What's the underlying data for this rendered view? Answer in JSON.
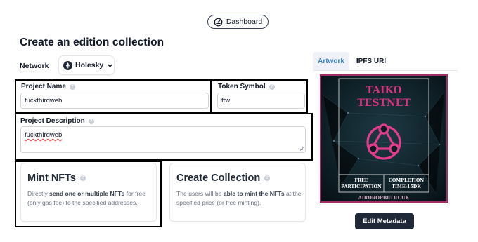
{
  "header": {
    "dashboard_label": "Dashboard"
  },
  "page": {
    "title": "Create an edition collection"
  },
  "network": {
    "label": "Network",
    "selected": "Holesky"
  },
  "form": {
    "project_name": {
      "label": "Project Name",
      "value": "fuckthirdweb"
    },
    "token_symbol": {
      "label": "Token Symbol",
      "value": "ftw"
    },
    "project_description": {
      "label": "Project Description",
      "value": "fuckthirdweb"
    }
  },
  "cards": {
    "mint": {
      "title": "Mint NFTs",
      "desc_part1": "Directly ",
      "desc_bold": "send one or multiple NFTs",
      "desc_part2": " for free (only gas fee) to the specified addresses."
    },
    "create": {
      "title": "Create Collection",
      "desc_part1": "The users will be ",
      "desc_bold": "able to mint the NFTs",
      "desc_part2": " at the specified price (or free minting)."
    }
  },
  "tabs": [
    {
      "label": "Artwork"
    },
    {
      "label": "IPFS URI"
    }
  ],
  "artwork": {
    "title_line1": "TAIKO",
    "title_line2": "TESTNET",
    "cell_left_1": "FREE",
    "cell_left_2": "PARTICIPATION",
    "cell_right_1": "COMPLETION",
    "cell_right_2": "TIME:15DK",
    "footer": "AIRDROPBULUCUK"
  },
  "buttons": {
    "edit_metadata": "Edit Metadata"
  },
  "colors": {
    "accent": "#3b82c4",
    "dark_button": "#1f2937",
    "artwork_pink": "#d6337f",
    "artwork_bg": "#0c1a22"
  }
}
